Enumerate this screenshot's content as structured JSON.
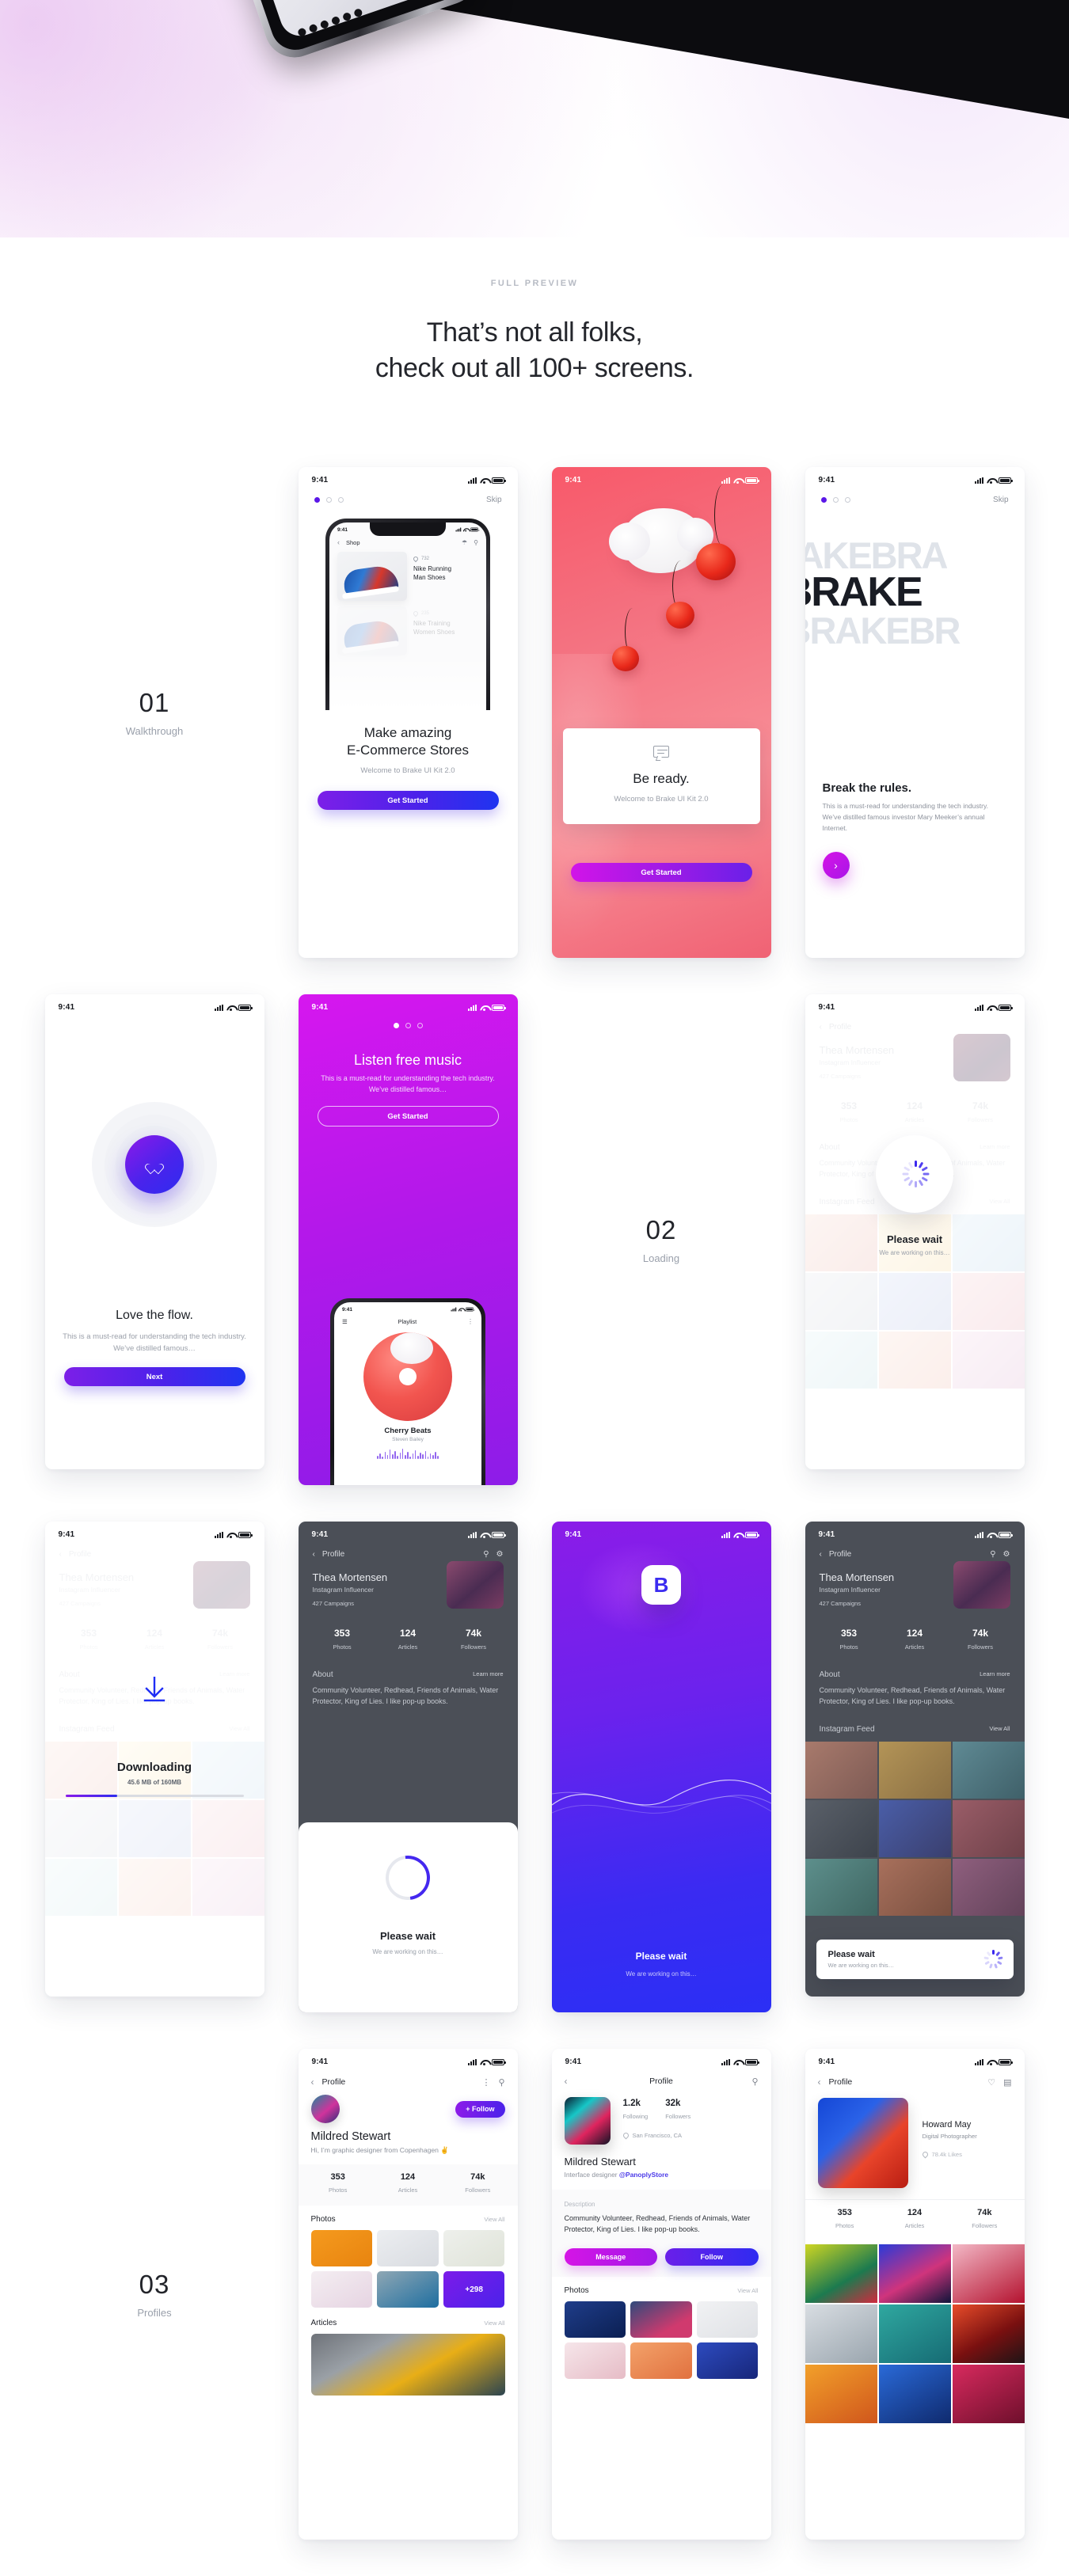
{
  "hero": {
    "device_alt": "iphone-bottom-edge"
  },
  "section": {
    "eyebrow": "FULL PREVIEW",
    "headline_line1": "That’s not all folks,",
    "headline_line2": "check out all 100+ screens."
  },
  "labels": [
    {
      "number": "01",
      "caption": "Walkthrough"
    },
    {
      "number": "02",
      "caption": "Loading"
    },
    {
      "number": "03",
      "caption": "Profiles"
    }
  ],
  "status_bar": {
    "time": "9:41"
  },
  "cards": {
    "ecommerce": {
      "skip": "Skip",
      "inner_nav_title": "Shop",
      "product_likes": "732",
      "product_name_line1": "Nike Running",
      "product_name_line2": "Man Shoes",
      "product2_likes": "235",
      "product2_name_line1": "Nike Training",
      "product2_name_line2": "Women Shoes",
      "title_line1": "Make amazing",
      "title_line2": "E-Commerce Stores",
      "subtitle": "Welcome to Brake UI Kit 2.0",
      "cta": "Get Started"
    },
    "be_ready": {
      "title": "Be ready.",
      "subtitle": "Welcome to Brake UI Kit 2.0",
      "cta": "Get Started"
    },
    "break_rules": {
      "skip": "Skip",
      "bg_text_line1": "RAKEBRA",
      "bg_text_line2": "KEBRAKE",
      "bg_text_line3": "BRAKEBR",
      "title": "Break the rules.",
      "body": "This is a must-read for understanding the tech industry. We’ve distilled famous investor Mary Meeker’s annual Internet.",
      "fab": "›"
    },
    "love_flow": {
      "title": "Love the flow.",
      "body": "This is a must-read for understanding the tech industry. We’ve distilled famous…",
      "cta": "Next"
    },
    "listen_music": {
      "title": "Listen free music",
      "body": "This is a must-read for understanding the tech industry. We’ve distilled famous…",
      "cta": "Get Started",
      "inner_nav_title": "Playlist",
      "track_title": "Cherry Beats",
      "track_artist": "Steven Bailey"
    },
    "loading_light": {
      "title": "Please wait",
      "subtitle": "We are working on this…"
    },
    "downloading": {
      "title": "Downloading",
      "subtitle": "45.6 MB of 160MB",
      "progress_percent": 29
    },
    "loading_sheet": {
      "title": "Please wait",
      "subtitle": "We are working on this…"
    },
    "splash": {
      "logo": "B",
      "title": "Please wait",
      "subtitle": "We are working on this…"
    },
    "loading_toast": {
      "title": "Please wait",
      "subtitle": "We are working on this…"
    },
    "profile_a": {
      "nav_title": "Profile",
      "follow": "+ Follow",
      "name": "Mildred Stewart",
      "bio": "Hi, I’m graphic designer from Copenhagen ✌",
      "stats": [
        {
          "value": "353",
          "label": "Photos"
        },
        {
          "value": "124",
          "label": "Articles"
        },
        {
          "value": "74k",
          "label": "Followers"
        }
      ],
      "photos_head": "Photos",
      "photos_view_all": "View All",
      "more_count": "+298",
      "articles_head": "Articles",
      "articles_view_all": "View All"
    },
    "profile_b": {
      "nav_title": "Profile",
      "following_value": "1.2k",
      "following_label": "Following",
      "followers_value": "32k",
      "followers_label": "Followers",
      "location": "San Francisco, CA",
      "name": "Mildred Stewart",
      "role_prefix": "Interface designer ",
      "handle": "@PanoplyStore",
      "description_label": "Description",
      "description": "Community Volunteer, Redhead, Friends of Animals, Water Protector, King of Lies. I like pop-up books.",
      "message_btn": "Message",
      "follow_btn": "Follow",
      "photos_head": "Photos",
      "photos_view_all": "View All"
    },
    "profile_c": {
      "nav_title": "Profile",
      "name": "Howard May",
      "role": "Digital Photographer",
      "likes": "78.4k Likes",
      "stats": [
        {
          "value": "353",
          "label": "Photos"
        },
        {
          "value": "124",
          "label": "Articles"
        },
        {
          "value": "74k",
          "label": "Followers"
        }
      ]
    },
    "ghost_profile": {
      "nav_title": "Profile",
      "name": "Thea Mortensen",
      "role": "Instagram Influencer",
      "campaigns": "427 Campaigns",
      "stats": [
        {
          "value": "353",
          "label": "Photos"
        },
        {
          "value": "124",
          "label": "Articles"
        },
        {
          "value": "74k",
          "label": "Followers"
        }
      ],
      "about_head": "About",
      "learn_more": "Learn more",
      "about_body": "Community Volunteer, Redhead, Friends of Animals, Water Protector, King of Lies. I like pop-up books.",
      "feed_head": "Instagram Feed",
      "feed_view_all": "View All"
    }
  },
  "colors": {
    "accent_purple": "#5a17e8",
    "accent_magenta": "#d114e8",
    "accent_blue": "#2f2cf0",
    "cherry_red": "#e8281a"
  }
}
